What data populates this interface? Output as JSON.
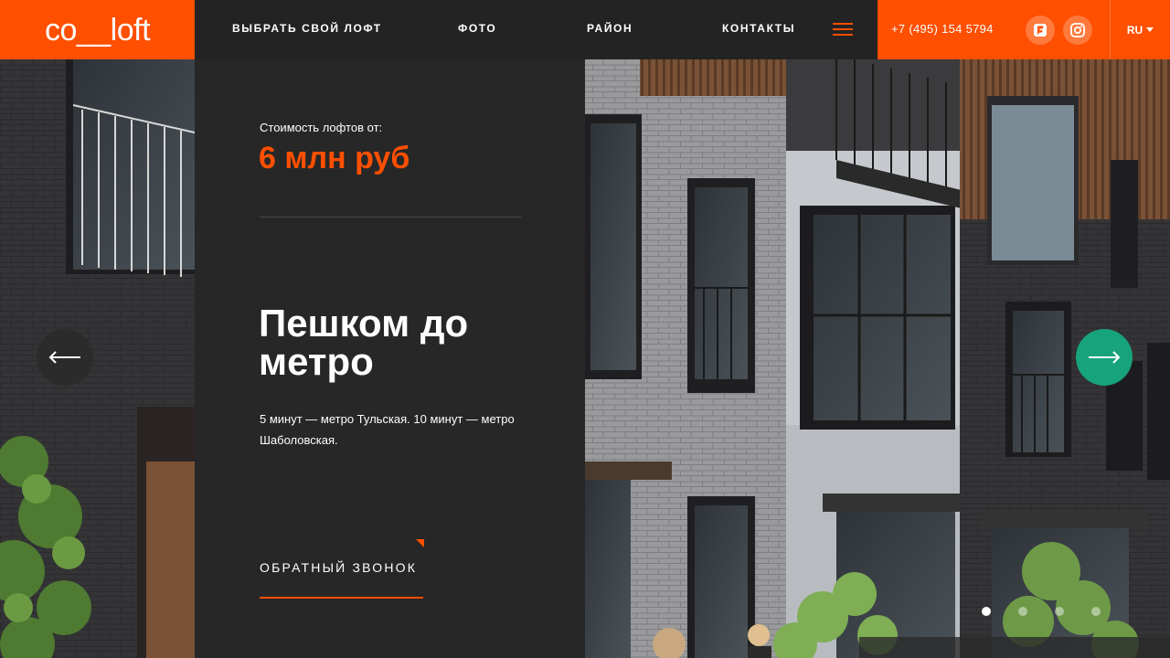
{
  "header": {
    "logo": "co__loft",
    "nav": [
      {
        "label": "ВЫБРАТЬ СВОЙ ЛОФТ"
      },
      {
        "label": "ФОТО"
      },
      {
        "label": "РАЙОН"
      },
      {
        "label": "КОНТАКТЫ"
      }
    ],
    "phone": "+7 (495) 154 5794",
    "social": [
      "foursquare-icon",
      "instagram-icon"
    ],
    "language": "RU"
  },
  "panel": {
    "price_label": "Стоимость лофтов от:",
    "price_value": "6 млн руб",
    "headline": "Пешком до метро",
    "description": "5 минут — метро Тульская. 10 минут — метро Шаболовская.",
    "callback_label": "ОБРАТНЫЙ ЗВОНОК"
  },
  "slider": {
    "prev_icon": "arrow-left-icon",
    "next_icon": "arrow-right-icon",
    "dots_count": 4,
    "active_dot": 1
  },
  "colors": {
    "accent": "#ff4f00",
    "panel": "#272727",
    "header": "#232323",
    "next_button": "#17a37b"
  }
}
